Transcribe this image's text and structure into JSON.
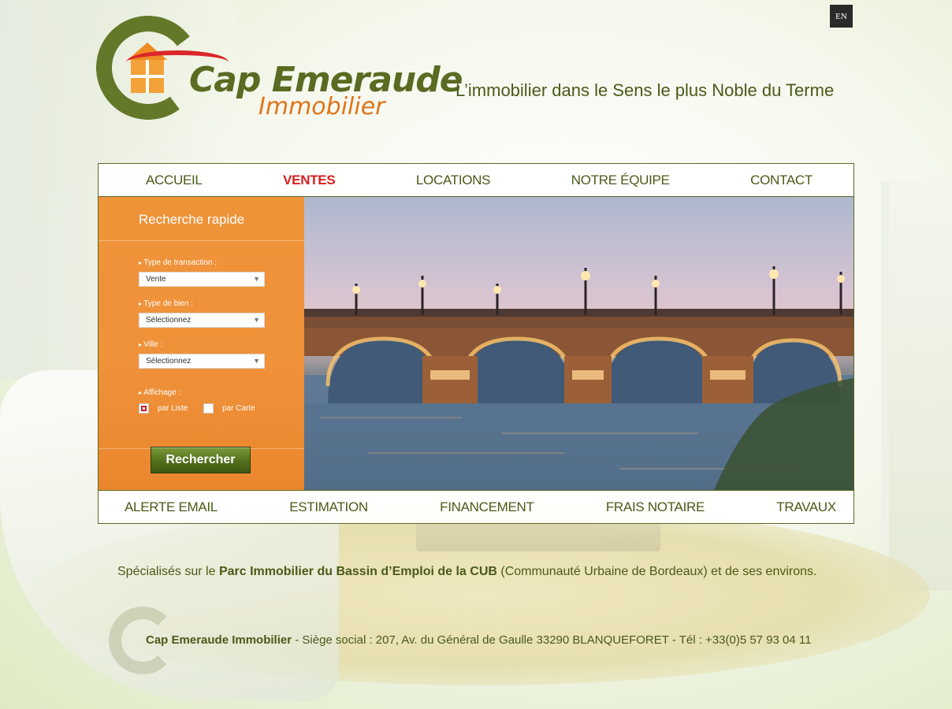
{
  "header": {
    "lang_button": "EN",
    "logo_title": "Cap Emeraude",
    "logo_subtitle": "Immobilier",
    "tagline": "L’immobilier dans le Sens le plus Noble du Terme"
  },
  "nav_top": {
    "items": [
      {
        "label": "ACCUEIL",
        "active": false
      },
      {
        "label": "VENTES",
        "active": true
      },
      {
        "label": "LOCATIONS",
        "active": false
      },
      {
        "label": "NOTRE ÉQUIPE",
        "active": false
      },
      {
        "label": "CONTACT",
        "active": false
      }
    ]
  },
  "search": {
    "title": "Recherche rapide",
    "transaction_label": "Type de transaction :",
    "transaction_value": "Vente",
    "property_label": "Type de bien :",
    "property_value": "Sélectionnez",
    "city_label": "Ville :",
    "city_value": "Sélectionnez",
    "display_label": "Affichage :",
    "display_list": "par Liste",
    "display_map": "par Carte",
    "submit": "Rechercher"
  },
  "nav_bottom": {
    "items": [
      {
        "label": "ALERTE EMAIL"
      },
      {
        "label": "ESTIMATION"
      },
      {
        "label": "FINANCEMENT"
      },
      {
        "label": "FRAIS NOTAIRE"
      },
      {
        "label": "TRAVAUX"
      }
    ]
  },
  "footer": {
    "specialty_prefix": "Spécialisés sur le ",
    "specialty_bold": "Parc Immobilier du Bassin d’Emploi de la CUB",
    "specialty_suffix": " (Communauté Urbaine de Bordeaux) et de ses environs.",
    "company_name": "Cap Emeraude Immobilier",
    "address": " - Siège social : 207, Av. du Général de Gaulle 33290 BLANQUEFORET - Tél : +33(0)5 57 93 04 11"
  },
  "colors": {
    "brand_green": "#5a6b22",
    "brand_orange": "#ef9339",
    "active_red": "#d81e1e"
  },
  "icons": {
    "select_arrow": "chevron-down-icon",
    "lang": "language-icon"
  }
}
